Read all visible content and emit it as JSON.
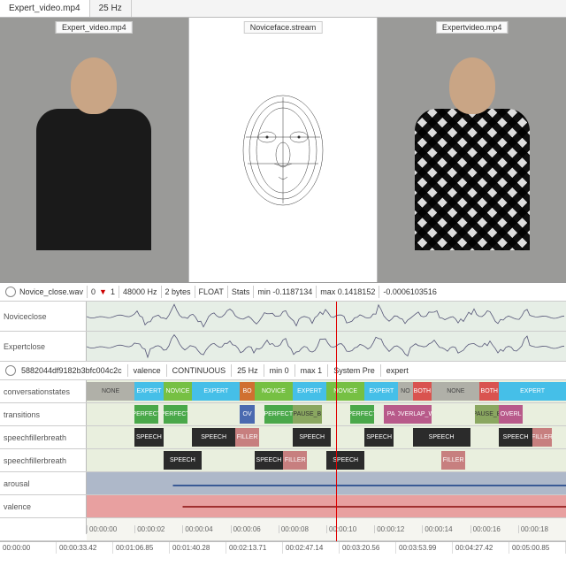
{
  "topTabs": {
    "file": "Expert_video.mp4",
    "rate": "25 Hz"
  },
  "panes": {
    "left": "Expert_video.mp4",
    "middle": "Noviceface.stream",
    "right": "Expertvideo.mp4"
  },
  "audioBar": {
    "file": "Novice_close.wav",
    "zero": "0",
    "one": "1",
    "sr": "48000 Hz",
    "bytes": "2 bytes",
    "fmt": "FLOAT",
    "stats": "Stats",
    "min": "min -0.1187134",
    "max": "max 0.1418152",
    "extra": "-0.0006103516"
  },
  "waveTracks": [
    {
      "label": "Noviceclose"
    },
    {
      "label": "Expertclose"
    }
  ],
  "streamHeader": {
    "id": "5882044df9182b3bfc004c2c",
    "chan": "valence",
    "mode": "CONTINUOUS",
    "rate": "25 Hz",
    "min": "min 0",
    "max": "max 1",
    "sys": "System Pre",
    "role": "expert"
  },
  "annoTracks": [
    {
      "label": "conversationstates",
      "segs": [
        {
          "l": 0,
          "w": 10,
          "c": "none",
          "t": "NONE"
        },
        {
          "l": 10,
          "w": 6,
          "c": "expert",
          "t": "EXPERT"
        },
        {
          "l": 16,
          "w": 6,
          "c": "novice",
          "t": "NOVICE"
        },
        {
          "l": 22,
          "w": 10,
          "c": "expert",
          "t": "EXPERT"
        },
        {
          "l": 32,
          "w": 3,
          "c": "bo",
          "t": "BO"
        },
        {
          "l": 35,
          "w": 8,
          "c": "novice",
          "t": "NOVICE"
        },
        {
          "l": 43,
          "w": 7,
          "c": "expert",
          "t": "EXPERT"
        },
        {
          "l": 50,
          "w": 8,
          "c": "novice",
          "t": "NOVICE"
        },
        {
          "l": 58,
          "w": 7,
          "c": "expert",
          "t": "EXPERT"
        },
        {
          "l": 65,
          "w": 3,
          "c": "none",
          "t": "NO"
        },
        {
          "l": 68,
          "w": 4,
          "c": "both",
          "t": "BOTH"
        },
        {
          "l": 72,
          "w": 10,
          "c": "none",
          "t": "NONE"
        },
        {
          "l": 82,
          "w": 4,
          "c": "both",
          "t": "BOTH"
        },
        {
          "l": 86,
          "w": 14,
          "c": "expert",
          "t": "EXPERT"
        }
      ]
    },
    {
      "label": "transitions",
      "segs": [
        {
          "l": 10,
          "w": 5,
          "c": "perfect",
          "t": "PERFECT"
        },
        {
          "l": 16,
          "w": 5,
          "c": "perfect",
          "t": "PERFECT"
        },
        {
          "l": 32,
          "w": 3,
          "c": "ov",
          "t": "OV"
        },
        {
          "l": 37,
          "w": 6,
          "c": "perfect",
          "t": "PERFECT"
        },
        {
          "l": 43,
          "w": 6,
          "c": "pauseb",
          "t": "PAUSE_B"
        },
        {
          "l": 55,
          "w": 5,
          "c": "perfect",
          "t": "PERFECT"
        },
        {
          "l": 62,
          "w": 3,
          "c": "overlap",
          "t": "PA"
        },
        {
          "l": 65,
          "w": 7,
          "c": "overlap",
          "t": "OVERLAP_W"
        },
        {
          "l": 81,
          "w": 5,
          "c": "pauseb",
          "t": "PAUSE_B"
        },
        {
          "l": 86,
          "w": 5,
          "c": "overlap",
          "t": "OVERL"
        }
      ]
    },
    {
      "label": "speechfillerbreath",
      "segs": [
        {
          "l": 10,
          "w": 6,
          "c": "speech",
          "t": "SPEECH"
        },
        {
          "l": 22,
          "w": 9,
          "c": "speech",
          "t": "SPEECH"
        },
        {
          "l": 31,
          "w": 5,
          "c": "filler",
          "t": "FILLER"
        },
        {
          "l": 43,
          "w": 8,
          "c": "speech",
          "t": "SPEECH"
        },
        {
          "l": 58,
          "w": 6,
          "c": "speech",
          "t": "SPEECH"
        },
        {
          "l": 68,
          "w": 12,
          "c": "speech",
          "t": "SPEECH"
        },
        {
          "l": 86,
          "w": 7,
          "c": "speech",
          "t": "SPEECH"
        },
        {
          "l": 93,
          "w": 4,
          "c": "filler",
          "t": "FILLER"
        }
      ]
    },
    {
      "label": "speechfillerbreath",
      "segs": [
        {
          "l": 16,
          "w": 8,
          "c": "speech",
          "t": "SPEECH"
        },
        {
          "l": 35,
          "w": 6,
          "c": "speech",
          "t": "SPEECH"
        },
        {
          "l": 41,
          "w": 5,
          "c": "filler",
          "t": "FILLER"
        },
        {
          "l": 50,
          "w": 8,
          "c": "speech",
          "t": "SPEECH"
        },
        {
          "l": 74,
          "w": 5,
          "c": "filler",
          "t": "FILLER"
        }
      ]
    }
  ],
  "contTracks": [
    {
      "label": "arousal",
      "bg": "arousal-bg",
      "line": "arousal-line"
    },
    {
      "label": "valence",
      "bg": "valence-bg",
      "line": "valence-line"
    }
  ],
  "subTimeTicks": [
    "00:00:00",
    "00:00:02",
    "00:00:04",
    "00:00:06",
    "00:00:08",
    "00:00:10",
    "00:00:12",
    "00:00:14",
    "00:00:16",
    "00:00:18"
  ],
  "globalTicks": [
    "00:00:00",
    "00:00:33.42",
    "00:01:06.85",
    "00:01:40.28",
    "00:02:13.71",
    "00:02:47.14",
    "00:03:20.56",
    "00:03:53.99",
    "00:04:27.42",
    "00:05:00.85"
  ]
}
